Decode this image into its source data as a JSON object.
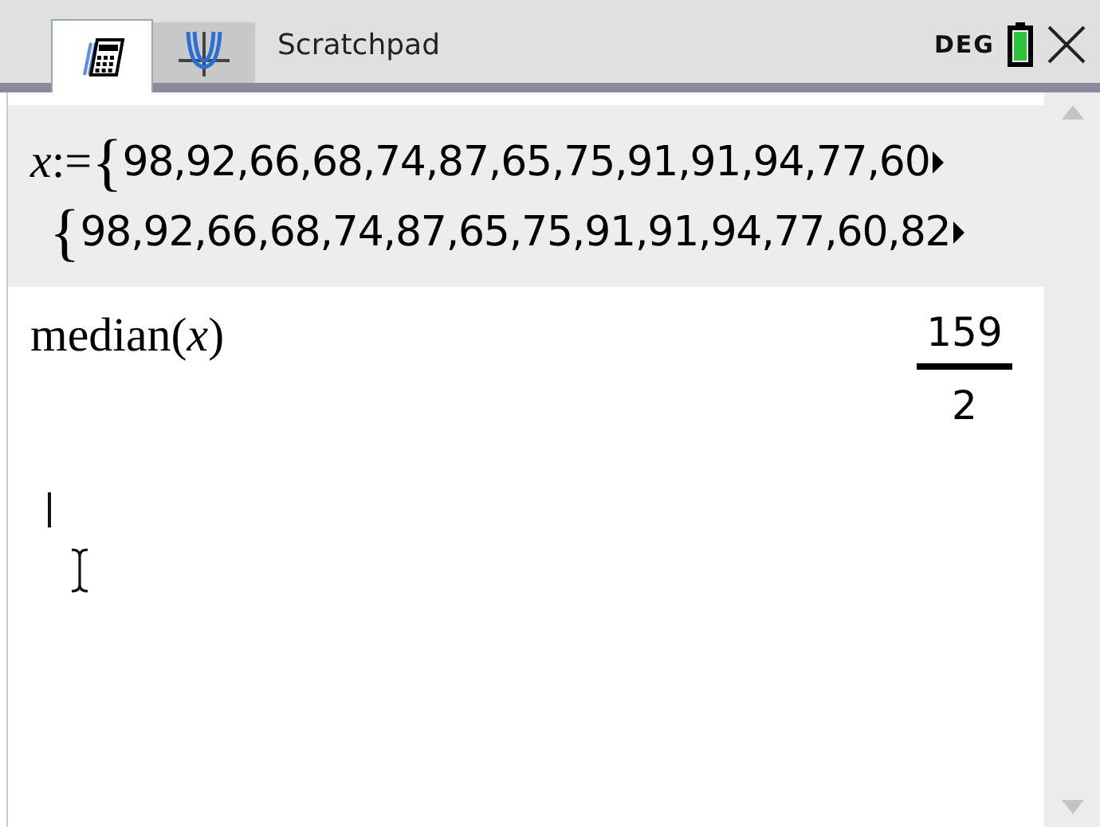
{
  "tabs": [
    {
      "kind": "calculator",
      "selected": true
    },
    {
      "kind": "graph",
      "selected": false
    }
  ],
  "title": "Scratchpad",
  "angle_mode": "DEG",
  "entries": [
    {
      "selected": true,
      "input_label": "*x*:=",
      "input_brace": "{",
      "input_values": "98,92,66,68,74,87,65,75,91,91,94,77,60",
      "kind": "list",
      "output_brace": "{",
      "output_values": "98,92,66,68,74,87,65,75,91,91,94,77,60,82"
    },
    {
      "selected": false,
      "input_label": "median(*x*)",
      "kind": "fraction",
      "numerator": "159",
      "denominator": "2"
    }
  ]
}
